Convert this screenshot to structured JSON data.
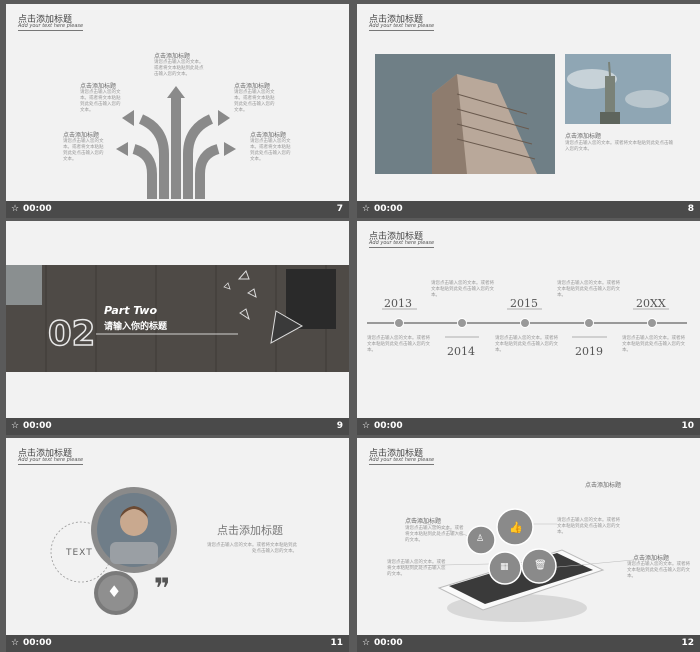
{
  "common": {
    "time": "00:00",
    "header_title": "点击添加标题",
    "header_sub": "Add your text here please",
    "add_title": "点击添加标题",
    "body": "请您点击输入您的文本。或者将文本粘贴到此处点击输入您的文本。",
    "body_short": "请您点击输入您的文本，或者将文本粘贴到此处"
  },
  "slides": [
    {
      "num": "7"
    },
    {
      "num": "8"
    },
    {
      "num": "9"
    },
    {
      "num": "10"
    },
    {
      "num": "11"
    },
    {
      "num": "12"
    }
  ],
  "slide9": {
    "number": "02",
    "part": "Part Two",
    "subtitle": "请输入你的标题"
  },
  "slide10": {
    "years": [
      "2013",
      "2014",
      "2015",
      "2019",
      "20XX"
    ]
  },
  "slide11": {
    "circle_text": "TEXT",
    "quote": "❞"
  }
}
